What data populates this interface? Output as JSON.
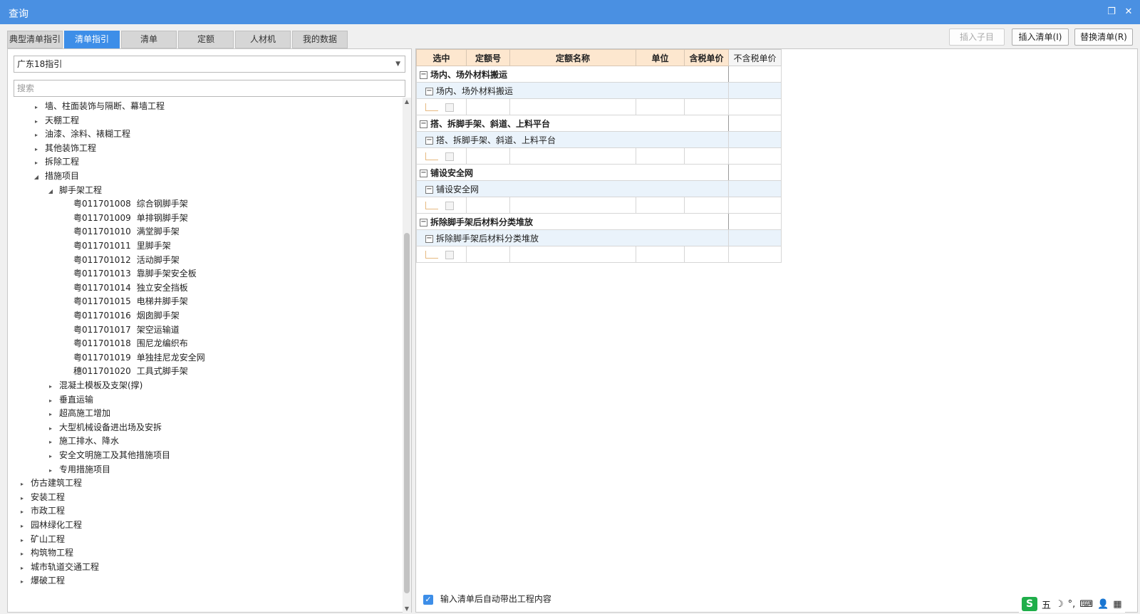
{
  "window": {
    "title": "查询",
    "restore_icon": "❐",
    "close_icon": "✕"
  },
  "tabs": [
    {
      "label": "典型清单指引",
      "active": false
    },
    {
      "label": "清单指引",
      "active": true
    },
    {
      "label": "清单",
      "active": false
    },
    {
      "label": "定额",
      "active": false
    },
    {
      "label": "人材机",
      "active": false
    },
    {
      "label": "我的数据",
      "active": false
    }
  ],
  "toolbar": {
    "insert_child": "插入子目",
    "insert_list": "插入清单(I)",
    "replace_list": "替换清单(R)"
  },
  "left": {
    "dropdown_value": "广东18指引",
    "search_placeholder": "搜索",
    "tree": [
      {
        "level": 2,
        "toggle": "▸",
        "label": "墙、柱面装饰与隔断、幕墙工程"
      },
      {
        "level": 2,
        "toggle": "▸",
        "label": "天棚工程"
      },
      {
        "level": 2,
        "toggle": "▸",
        "label": "油漆、涂料、裱糊工程"
      },
      {
        "level": 2,
        "toggle": "▸",
        "label": "其他装饰工程"
      },
      {
        "level": 2,
        "toggle": "▸",
        "label": "拆除工程"
      },
      {
        "level": 2,
        "toggle": "◢",
        "label": "措施项目"
      },
      {
        "level": 3,
        "toggle": "◢",
        "label": "脚手架工程"
      },
      {
        "level": 4,
        "code": "粤011701008",
        "label": "综合钢脚手架"
      },
      {
        "level": 4,
        "code": "粤011701009",
        "label": "单排钢脚手架"
      },
      {
        "level": 4,
        "code": "粤011701010",
        "label": "满堂脚手架"
      },
      {
        "level": 4,
        "code": "粤011701011",
        "label": "里脚手架"
      },
      {
        "level": 4,
        "code": "粤011701012",
        "label": "活动脚手架"
      },
      {
        "level": 4,
        "code": "粤011701013",
        "label": "靠脚手架安全板"
      },
      {
        "level": 4,
        "code": "粤011701014",
        "label": "独立安全挡板"
      },
      {
        "level": 4,
        "code": "粤011701015",
        "label": "电梯井脚手架"
      },
      {
        "level": 4,
        "code": "粤011701016",
        "label": "烟囱脚手架"
      },
      {
        "level": 4,
        "code": "粤011701017",
        "label": "架空运输道"
      },
      {
        "level": 4,
        "code": "粤011701018",
        "label": "围尼龙编织布"
      },
      {
        "level": 4,
        "code": "粤011701019",
        "label": "单独挂尼龙安全网"
      },
      {
        "level": 4,
        "code": "穗011701020",
        "label": "工具式脚手架"
      },
      {
        "level": 3,
        "toggle": "▸",
        "label": "混凝土模板及支架(撑)"
      },
      {
        "level": 3,
        "toggle": "▸",
        "label": "垂直运输"
      },
      {
        "level": 3,
        "toggle": "▸",
        "label": "超高施工增加"
      },
      {
        "level": 3,
        "toggle": "▸",
        "label": "大型机械设备进出场及安拆"
      },
      {
        "level": 3,
        "toggle": "▸",
        "label": "施工排水、降水"
      },
      {
        "level": 3,
        "toggle": "▸",
        "label": "安全文明施工及其他措施项目"
      },
      {
        "level": 3,
        "toggle": "▸",
        "label": "专用措施项目"
      },
      {
        "level": 1,
        "toggle": "▸",
        "label": "仿古建筑工程"
      },
      {
        "level": 1,
        "toggle": "▸",
        "label": "安装工程"
      },
      {
        "level": 1,
        "toggle": "▸",
        "label": "市政工程"
      },
      {
        "level": 1,
        "toggle": "▸",
        "label": "园林绿化工程"
      },
      {
        "level": 1,
        "toggle": "▸",
        "label": "矿山工程"
      },
      {
        "level": 1,
        "toggle": "▸",
        "label": "构筑物工程"
      },
      {
        "level": 1,
        "toggle": "▸",
        "label": "城市轨道交通工程"
      },
      {
        "level": 1,
        "toggle": "▸",
        "label": "爆破工程"
      }
    ]
  },
  "grid": {
    "headers": [
      "选中",
      "定额号",
      "定额名称",
      "单位",
      "含税单价",
      "不含税单价"
    ],
    "groups": [
      {
        "title": "场内、场外材料搬运",
        "sub": "场内、场外材料搬运"
      },
      {
        "title": "搭、拆脚手架、斜道、上料平台",
        "sub": "搭、拆脚手架、斜道、上料平台"
      },
      {
        "title": "铺设安全网",
        "sub": "铺设安全网"
      },
      {
        "title": "拆除脚手架后材料分类堆放",
        "sub": "拆除脚手架后材料分类堆放"
      }
    ]
  },
  "options": {
    "auto_bring_content": "输入清单后自动带出工程内容"
  },
  "ime": {
    "logo": "S",
    "mode": "五",
    "moon": "☽",
    "punct": "°,",
    "keyboard": "⌨",
    "user": "👤",
    "tools": "▦"
  }
}
